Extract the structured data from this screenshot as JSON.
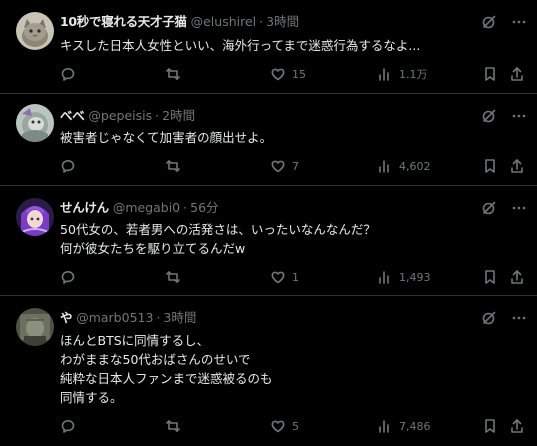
{
  "colors": {
    "background": "#000000",
    "text": "#e7e9ea",
    "muted": "#71767b",
    "divider": "#2f3336"
  },
  "icons": [
    "reply-icon",
    "retweet-icon",
    "like-icon",
    "views-icon",
    "bookmark-icon",
    "share-icon",
    "grok-icon",
    "more-icon"
  ],
  "tweets": [
    {
      "name": "10秒で寝れる天才子猫",
      "handle": "@elushirel",
      "time": "3時間",
      "lines": [
        "キスした日本人女性といい、海外行ってまで迷惑行為するなよ..."
      ],
      "likes": "15",
      "views": "1.1万",
      "replies": "",
      "retweets": ""
    },
    {
      "name": "べべ",
      "handle": "@pepeisis",
      "time": "2時間",
      "lines": [
        "被害者じゃなくて加害者の顔出せよ。"
      ],
      "likes": "7",
      "views": "4,602",
      "replies": "",
      "retweets": ""
    },
    {
      "name": "せんけん",
      "handle": "@megabi0",
      "time": "56分",
      "lines": [
        "50代女の、若者男への活発さは、いったいなんなんだ？",
        "何が彼女たちを駆り立てるんだw"
      ],
      "likes": "1",
      "views": "1,493",
      "replies": "",
      "retweets": ""
    },
    {
      "name": "や",
      "handle": "@marb0513",
      "time": "3時間",
      "lines": [
        "ほんとBTSに同情するし、",
        "わがままな50代おばさんのせいで",
        "純粋な日本人ファンまで迷惑被るのも",
        "同情する。"
      ],
      "likes": "5",
      "views": "7,486",
      "replies": "",
      "retweets": ""
    }
  ]
}
